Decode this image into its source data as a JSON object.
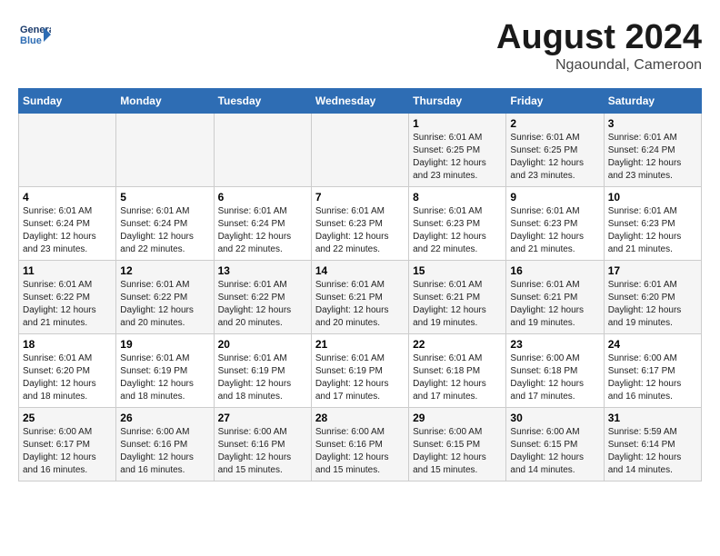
{
  "header": {
    "logo_line1": "General",
    "logo_line2": "Blue",
    "month_year": "August 2024",
    "location": "Ngaoundal, Cameroon"
  },
  "weekdays": [
    "Sunday",
    "Monday",
    "Tuesday",
    "Wednesday",
    "Thursday",
    "Friday",
    "Saturday"
  ],
  "weeks": [
    [
      {
        "day": "",
        "info": ""
      },
      {
        "day": "",
        "info": ""
      },
      {
        "day": "",
        "info": ""
      },
      {
        "day": "",
        "info": ""
      },
      {
        "day": "1",
        "info": "Sunrise: 6:01 AM\nSunset: 6:25 PM\nDaylight: 12 hours\nand 23 minutes."
      },
      {
        "day": "2",
        "info": "Sunrise: 6:01 AM\nSunset: 6:25 PM\nDaylight: 12 hours\nand 23 minutes."
      },
      {
        "day": "3",
        "info": "Sunrise: 6:01 AM\nSunset: 6:24 PM\nDaylight: 12 hours\nand 23 minutes."
      }
    ],
    [
      {
        "day": "4",
        "info": "Sunrise: 6:01 AM\nSunset: 6:24 PM\nDaylight: 12 hours\nand 23 minutes."
      },
      {
        "day": "5",
        "info": "Sunrise: 6:01 AM\nSunset: 6:24 PM\nDaylight: 12 hours\nand 22 minutes."
      },
      {
        "day": "6",
        "info": "Sunrise: 6:01 AM\nSunset: 6:24 PM\nDaylight: 12 hours\nand 22 minutes."
      },
      {
        "day": "7",
        "info": "Sunrise: 6:01 AM\nSunset: 6:23 PM\nDaylight: 12 hours\nand 22 minutes."
      },
      {
        "day": "8",
        "info": "Sunrise: 6:01 AM\nSunset: 6:23 PM\nDaylight: 12 hours\nand 22 minutes."
      },
      {
        "day": "9",
        "info": "Sunrise: 6:01 AM\nSunset: 6:23 PM\nDaylight: 12 hours\nand 21 minutes."
      },
      {
        "day": "10",
        "info": "Sunrise: 6:01 AM\nSunset: 6:23 PM\nDaylight: 12 hours\nand 21 minutes."
      }
    ],
    [
      {
        "day": "11",
        "info": "Sunrise: 6:01 AM\nSunset: 6:22 PM\nDaylight: 12 hours\nand 21 minutes."
      },
      {
        "day": "12",
        "info": "Sunrise: 6:01 AM\nSunset: 6:22 PM\nDaylight: 12 hours\nand 20 minutes."
      },
      {
        "day": "13",
        "info": "Sunrise: 6:01 AM\nSunset: 6:22 PM\nDaylight: 12 hours\nand 20 minutes."
      },
      {
        "day": "14",
        "info": "Sunrise: 6:01 AM\nSunset: 6:21 PM\nDaylight: 12 hours\nand 20 minutes."
      },
      {
        "day": "15",
        "info": "Sunrise: 6:01 AM\nSunset: 6:21 PM\nDaylight: 12 hours\nand 19 minutes."
      },
      {
        "day": "16",
        "info": "Sunrise: 6:01 AM\nSunset: 6:21 PM\nDaylight: 12 hours\nand 19 minutes."
      },
      {
        "day": "17",
        "info": "Sunrise: 6:01 AM\nSunset: 6:20 PM\nDaylight: 12 hours\nand 19 minutes."
      }
    ],
    [
      {
        "day": "18",
        "info": "Sunrise: 6:01 AM\nSunset: 6:20 PM\nDaylight: 12 hours\nand 18 minutes."
      },
      {
        "day": "19",
        "info": "Sunrise: 6:01 AM\nSunset: 6:19 PM\nDaylight: 12 hours\nand 18 minutes."
      },
      {
        "day": "20",
        "info": "Sunrise: 6:01 AM\nSunset: 6:19 PM\nDaylight: 12 hours\nand 18 minutes."
      },
      {
        "day": "21",
        "info": "Sunrise: 6:01 AM\nSunset: 6:19 PM\nDaylight: 12 hours\nand 17 minutes."
      },
      {
        "day": "22",
        "info": "Sunrise: 6:01 AM\nSunset: 6:18 PM\nDaylight: 12 hours\nand 17 minutes."
      },
      {
        "day": "23",
        "info": "Sunrise: 6:00 AM\nSunset: 6:18 PM\nDaylight: 12 hours\nand 17 minutes."
      },
      {
        "day": "24",
        "info": "Sunrise: 6:00 AM\nSunset: 6:17 PM\nDaylight: 12 hours\nand 16 minutes."
      }
    ],
    [
      {
        "day": "25",
        "info": "Sunrise: 6:00 AM\nSunset: 6:17 PM\nDaylight: 12 hours\nand 16 minutes."
      },
      {
        "day": "26",
        "info": "Sunrise: 6:00 AM\nSunset: 6:16 PM\nDaylight: 12 hours\nand 16 minutes."
      },
      {
        "day": "27",
        "info": "Sunrise: 6:00 AM\nSunset: 6:16 PM\nDaylight: 12 hours\nand 15 minutes."
      },
      {
        "day": "28",
        "info": "Sunrise: 6:00 AM\nSunset: 6:16 PM\nDaylight: 12 hours\nand 15 minutes."
      },
      {
        "day": "29",
        "info": "Sunrise: 6:00 AM\nSunset: 6:15 PM\nDaylight: 12 hours\nand 15 minutes."
      },
      {
        "day": "30",
        "info": "Sunrise: 6:00 AM\nSunset: 6:15 PM\nDaylight: 12 hours\nand 14 minutes."
      },
      {
        "day": "31",
        "info": "Sunrise: 5:59 AM\nSunset: 6:14 PM\nDaylight: 12 hours\nand 14 minutes."
      }
    ]
  ]
}
